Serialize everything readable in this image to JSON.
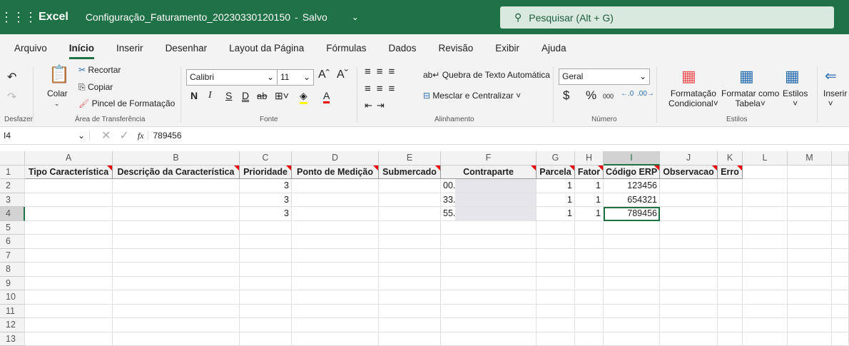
{
  "header": {
    "app": "Excel",
    "doc_title": "Configuração_Faturamento_20230330120150",
    "separator": "-",
    "status": "Salvo",
    "search_placeholder": "Pesquisar (Alt + G)"
  },
  "tabs": [
    "Arquivo",
    "Início",
    "Inserir",
    "Desenhar",
    "Layout da Página",
    "Fórmulas",
    "Dados",
    "Revisão",
    "Exibir",
    "Ajuda"
  ],
  "ribbon": {
    "undo_group": "Desfazer",
    "clipboard": {
      "paste": "Colar",
      "cut": "Recortar",
      "copy": "Copiar",
      "format_painter": "Pincel de Formatação",
      "group": "Área de Transferência"
    },
    "font": {
      "name": "Calibri",
      "size": "11",
      "bold": "N",
      "italic": "I",
      "underline": "S",
      "double_underline": "D",
      "strike": "ab",
      "group": "Fonte"
    },
    "alignment": {
      "wrap": "Quebra de Texto Automática",
      "merge": "Mesclar e Centralizar",
      "group": "Alinhamento"
    },
    "number": {
      "format": "Geral",
      "currency": "$",
      "percent": "%",
      "thousands": "000",
      "group": "Número"
    },
    "styles": {
      "conditional1": "Formatação",
      "conditional2": "Condicional",
      "table1": "Formatar como",
      "table2": "Tabela",
      "styles": "Estilos",
      "group": "Estilos"
    },
    "cells": {
      "insert": "Inserir"
    }
  },
  "formula_bar": {
    "name_box": "I4",
    "fx": "fx",
    "value": "789456"
  },
  "columns": [
    "A",
    "B",
    "C",
    "D",
    "E",
    "F",
    "G",
    "H",
    "I",
    "J",
    "K",
    "L",
    "M"
  ],
  "rows": [
    "1",
    "2",
    "3",
    "4",
    "5",
    "6",
    "7",
    "8",
    "9",
    "10",
    "11",
    "12",
    "13"
  ],
  "table": {
    "headers": [
      "Tipo Característica",
      "Descrição da Característica",
      "Prioridade",
      "Ponto de Medição",
      "Submercado",
      "Contraparte",
      "Parcela",
      "Fator",
      "Código ERP",
      "Observacao",
      "Erro"
    ],
    "data": [
      [
        "",
        "",
        "3",
        "",
        "",
        "00.",
        "1",
        "1",
        "123456",
        "",
        ""
      ],
      [
        "",
        "",
        "3",
        "",
        "",
        "33.",
        "1",
        "1",
        "654321",
        "",
        ""
      ],
      [
        "",
        "",
        "3",
        "",
        "",
        "55.",
        "1",
        "1",
        "789456",
        "",
        ""
      ]
    ]
  },
  "selected_cell": "I4"
}
